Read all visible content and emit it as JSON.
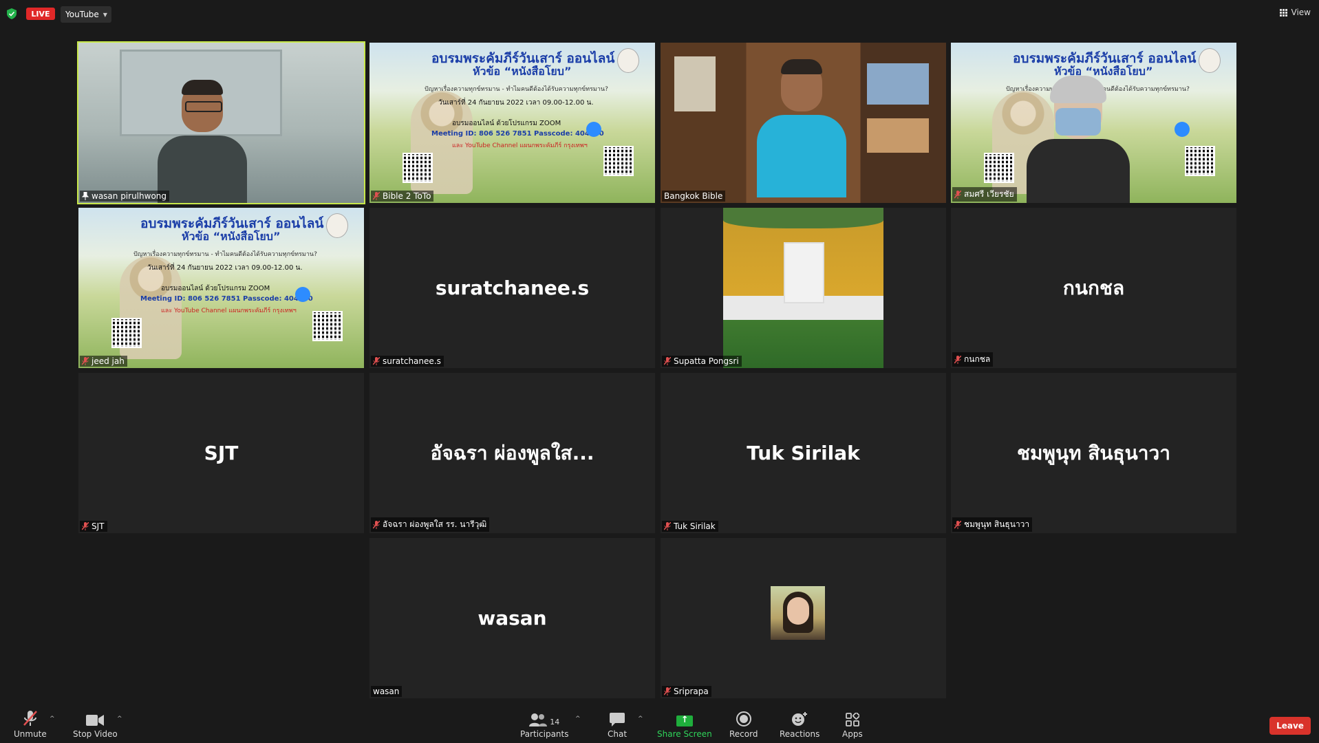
{
  "top": {
    "live_label": "LIVE",
    "stream_target": "YouTube",
    "view_label": "View"
  },
  "poster": {
    "title": "อบรมพระคัมภีร์วันเสาร์ ออนไลน์",
    "subtitle": "หัวข้อ “หนังสือโยบ”",
    "question": "ปัญหาเรื่องความทุกข์ทรมาน - ทำไมคนดีต้องได้รับความทุกข์ทรมาน?",
    "date": "วันเสาร์ที่ 24 กันยายน 2022  เวลา 09.00-12.00 น.",
    "zoom_line": "อบรมออนไลน์ ด้วยโปรแกรม ZOOM",
    "meeting": "Meeting ID: 806 526 7851   Passcode: 404040",
    "youtube_line": "และ YouTube Channel แผนกพระคัมภีร์ กรุงเทพฯ"
  },
  "participants": [
    {
      "label": "wasan pirulhwong",
      "display": "",
      "kind": "camera-man-glasses",
      "muted": false,
      "pinned_icon": true,
      "active": true
    },
    {
      "label": "Bible 2 ToTo",
      "display": "",
      "kind": "poster",
      "muted": true
    },
    {
      "label": "Bangkok Bible",
      "display": "",
      "kind": "camera-man-blue",
      "muted": false
    },
    {
      "label": "สมศรี เวียรชัย",
      "display": "",
      "kind": "poster-woman",
      "muted": true
    },
    {
      "label": "jeed jah",
      "display": "",
      "kind": "poster",
      "muted": true
    },
    {
      "label": "suratchanee.s",
      "display": "suratchanee.s",
      "kind": "name",
      "muted": true
    },
    {
      "label": "Supatta Pongsri",
      "display": "",
      "kind": "house-photo",
      "muted": true
    },
    {
      "label": "กนกชล",
      "display": "กนกชล",
      "kind": "name",
      "muted": true
    },
    {
      "label": "SJT",
      "display": "SJT",
      "kind": "name",
      "muted": true
    },
    {
      "label": "อัจฉรา  ผ่องพูลใส  รร. นารีวุฒิ",
      "display": "อัจฉรา  ผ่องพูลใส...",
      "kind": "name",
      "muted": true
    },
    {
      "label": "Tuk Sirilak",
      "display": "Tuk Sirilak",
      "kind": "name",
      "muted": true
    },
    {
      "label": "ชมพูนุท สินธุนาวา",
      "display": "ชมพูนุท สินธุนาวา",
      "kind": "name",
      "muted": true
    },
    {
      "label": "wasan",
      "display": "wasan",
      "kind": "name",
      "muted": false
    },
    {
      "label": "Sriprapa",
      "display": "",
      "kind": "avatar-photo",
      "muted": true
    }
  ],
  "toolbar": {
    "unmute": "Unmute",
    "stop_video": "Stop Video",
    "participants": "Participants",
    "participants_count": "14",
    "chat": "Chat",
    "share_screen": "Share Screen",
    "record": "Record",
    "reactions": "Reactions",
    "apps": "Apps",
    "leave": "Leave"
  },
  "colors": {
    "background": "#1a1a1a",
    "tile": "#232323",
    "live": "#e02828",
    "active_speaker": "#c8e84a",
    "share": "#1fae3c",
    "leave": "#d9332b",
    "mute": "#e05050"
  }
}
